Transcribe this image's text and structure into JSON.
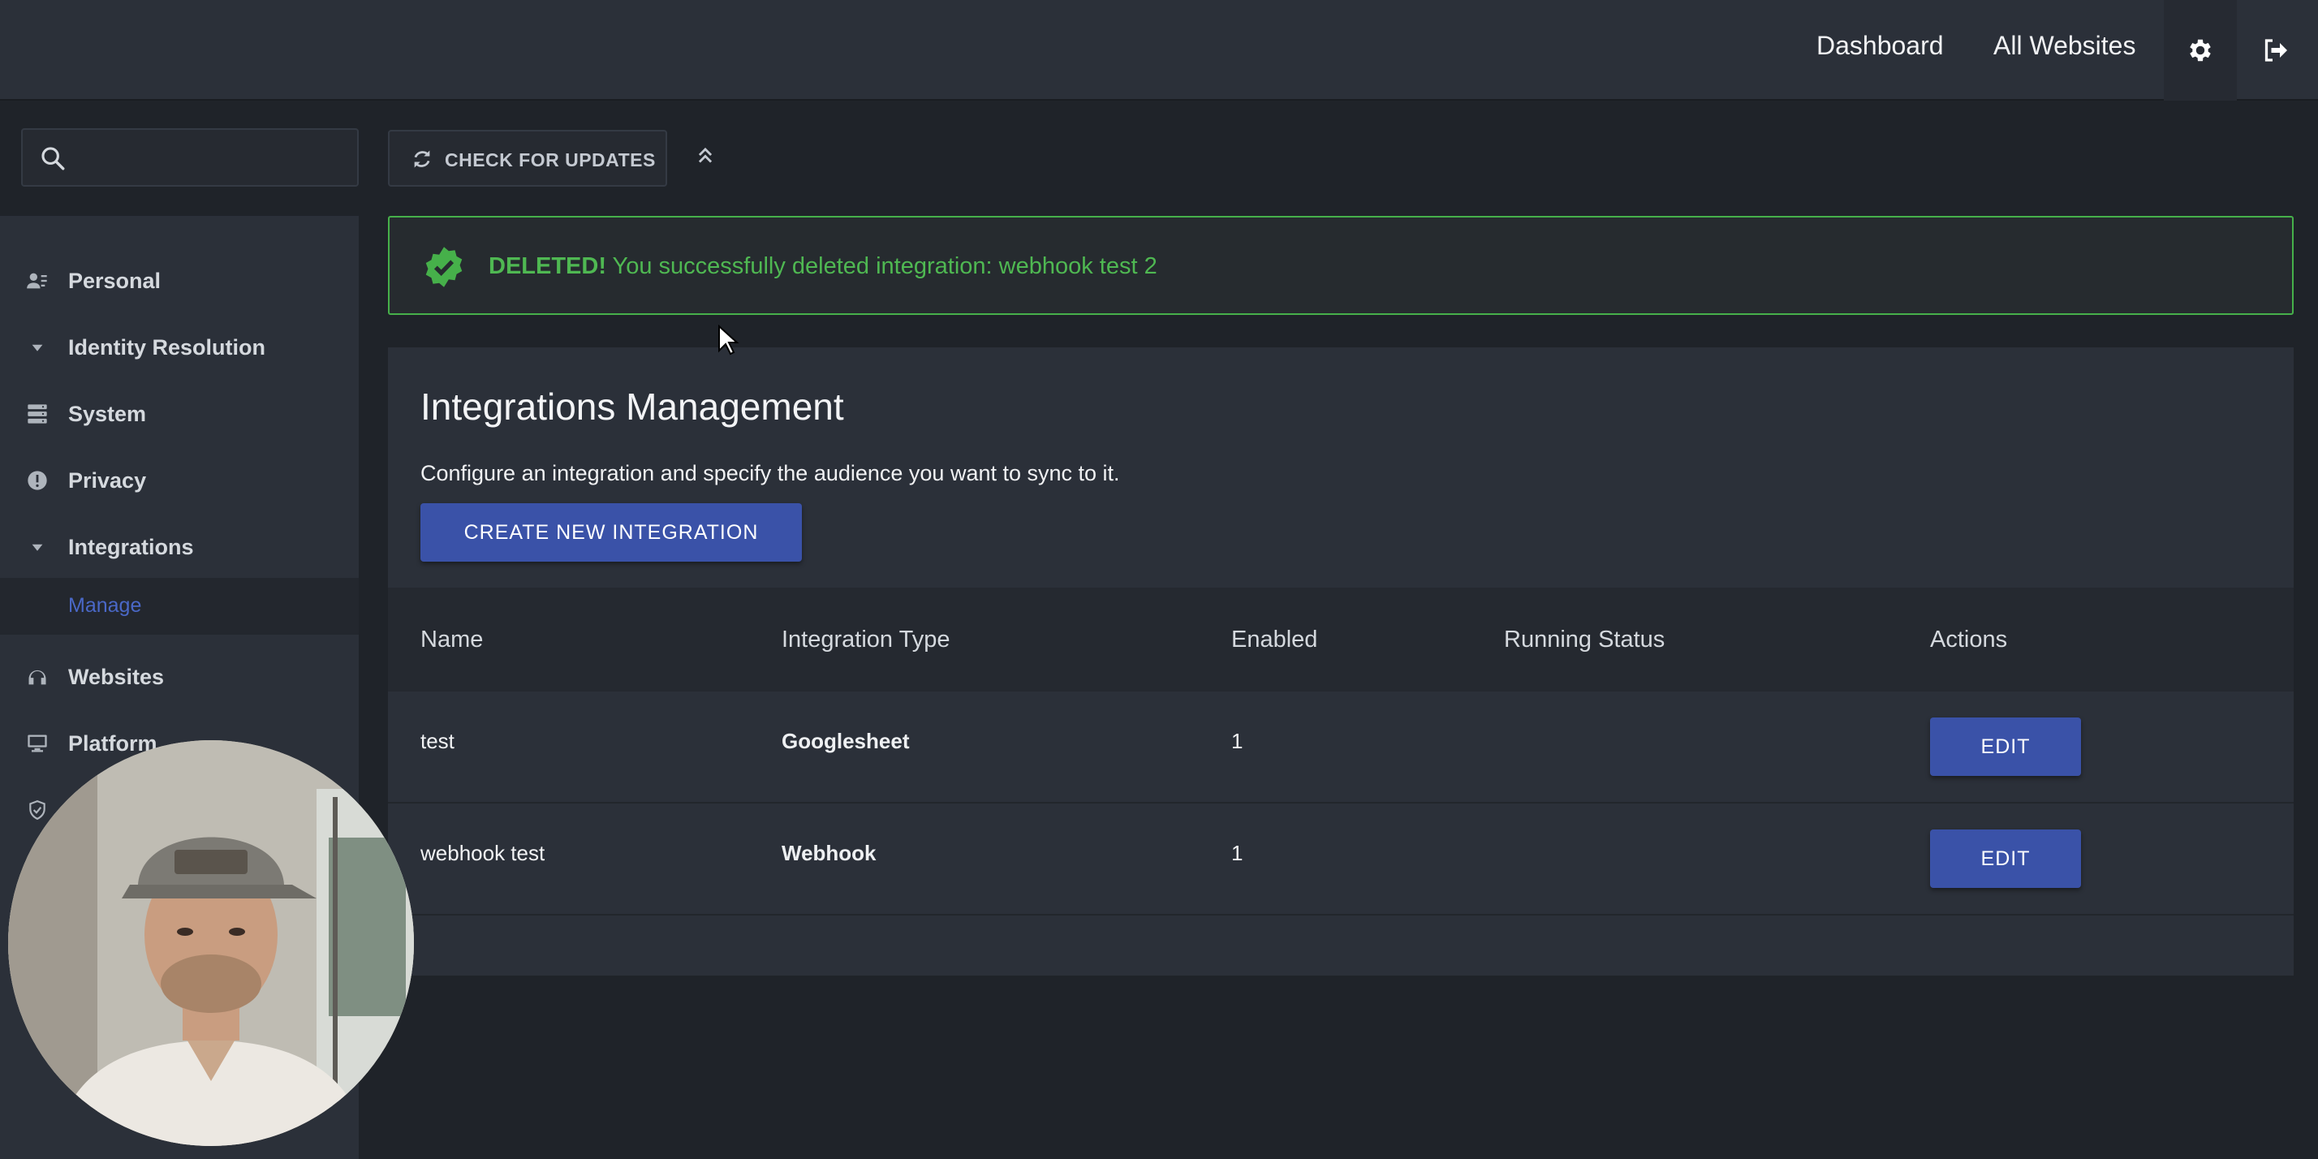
{
  "header": {
    "nav": [
      "Dashboard",
      "All Websites"
    ],
    "icons": [
      "gear-icon",
      "logout-icon"
    ]
  },
  "search": {
    "placeholder": "",
    "value": ""
  },
  "toolbar": {
    "check_updates_label": "CHECK FOR UPDATES"
  },
  "sidebar": {
    "items": [
      {
        "label": "Personal",
        "icon": "user-card-icon"
      },
      {
        "label": "Identity Resolution",
        "icon": "caret-down-icon"
      },
      {
        "label": "System",
        "icon": "server-icon"
      },
      {
        "label": "Privacy",
        "icon": "info-circle-icon"
      },
      {
        "label": "Integrations",
        "icon": "caret-down-icon"
      },
      {
        "label": "Websites",
        "icon": "headset-icon"
      },
      {
        "label": "Platform",
        "icon": "monitor-icon"
      },
      {
        "label": "",
        "icon": "shield-check-icon"
      }
    ],
    "sub_active": "Manage"
  },
  "alert": {
    "strong": "DELETED!",
    "text": " You successfully deleted integration: webhook test 2",
    "color": "#4fb852"
  },
  "card": {
    "title": "Integrations Management",
    "description": "Configure an integration and specify the audience you want to sync to it.",
    "create_label": "CREATE NEW INTEGRATION"
  },
  "table": {
    "columns": [
      "Name",
      "Integration Type",
      "Enabled",
      "Running Status",
      "Actions"
    ],
    "rows": [
      {
        "name": "test",
        "type": "Googlesheet",
        "enabled": "1",
        "status": "",
        "action": "EDIT"
      },
      {
        "name": "webhook test",
        "type": "Webhook",
        "enabled": "1",
        "status": "",
        "action": "EDIT"
      }
    ]
  },
  "colors": {
    "accent": "#3a52a8",
    "success": "#46b04a",
    "link": "#4a68c7"
  }
}
